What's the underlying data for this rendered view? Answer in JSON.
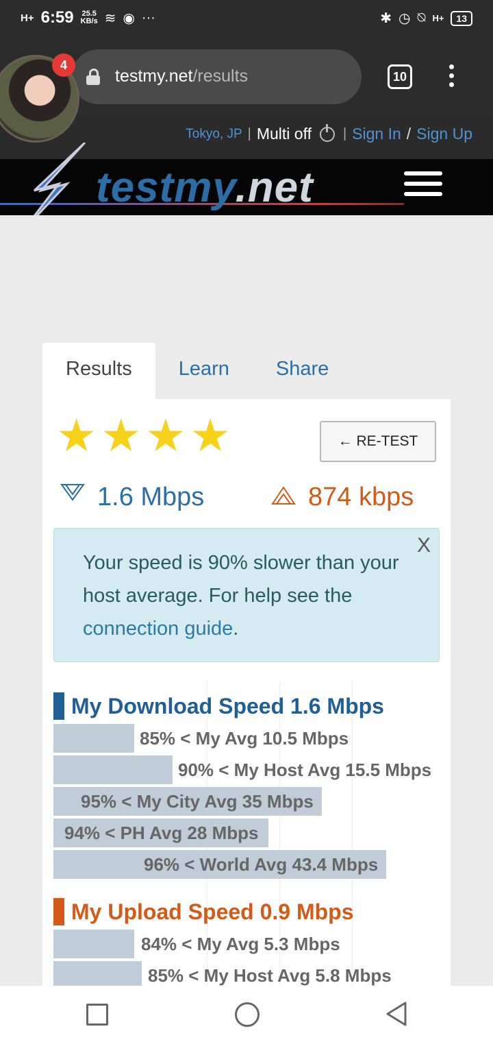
{
  "status_bar": {
    "network": "H+",
    "time": "6:59",
    "speed_value": "25.5",
    "speed_unit": "KB/s",
    "more": "···",
    "network_right": "H+",
    "battery": "13"
  },
  "browser": {
    "url_domain": "testmy.net",
    "url_path": "/results",
    "tab_count": "10",
    "notification_count": "4"
  },
  "user_bar": {
    "location": "Tokyo, JP",
    "divider": "|",
    "multi": "Multi off",
    "sign_in": "Sign In",
    "slash": "/",
    "sign_up": "Sign Up"
  },
  "logo": {
    "part1": "testmy",
    "part2": ".net"
  },
  "tabs": {
    "results": "Results",
    "learn": "Learn",
    "share": "Share"
  },
  "rating": {
    "stars": 4,
    "star_glyph": "★"
  },
  "retest_label": "← RE-TEST",
  "speeds": {
    "download": "1.6 Mbps",
    "upload": "874 kbps"
  },
  "alert": {
    "text_before": "Your speed is 90% slower than your host average. For help see the ",
    "link": "connection guide",
    "text_after": ".",
    "close": "X"
  },
  "download_section": {
    "title": "My Download Speed 1.6 Mbps",
    "bars": [
      {
        "label": "85% < My Avg 10.5 Mbps",
        "value_mbps": 10.5
      },
      {
        "label": "90% < My Host Avg 15.5 Mbps",
        "value_mbps": 15.5
      },
      {
        "label": "95% < My City Avg 35 Mbps",
        "value_mbps": 35
      },
      {
        "label": "94% < PH Avg 28 Mbps",
        "value_mbps": 28
      },
      {
        "label": "96% < World Avg 43.4 Mbps",
        "value_mbps": 43.4
      }
    ]
  },
  "upload_section": {
    "title": "My Upload Speed 0.9 Mbps",
    "bars": [
      {
        "label": "84% < My Avg 5.3 Mbps",
        "value_mbps": 5.3
      },
      {
        "label": "85% < My Host Avg 5.8 Mbps",
        "value_mbps": 5.8
      }
    ]
  },
  "colors": {
    "accent_blue": "#2a6fa8",
    "upload_orange": "#d35a18",
    "star_yellow": "#f7d21b",
    "alert_bg": "#d4ebf1"
  }
}
